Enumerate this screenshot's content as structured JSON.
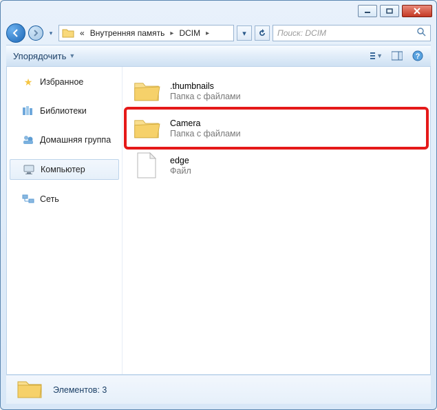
{
  "breadcrumb": {
    "prefix": "«",
    "seg1": "Внутренняя память",
    "seg2": "DCIM"
  },
  "search": {
    "placeholder": "Поиск: DCIM"
  },
  "toolbar": {
    "organize": "Упорядочить"
  },
  "nav": {
    "favorites": "Избранное",
    "libraries": "Библиотеки",
    "homegroup": "Домашняя группа",
    "computer": "Компьютер",
    "network": "Сеть"
  },
  "items": [
    {
      "name": ".thumbnails",
      "type": "Папка с файлами",
      "kind": "folder"
    },
    {
      "name": "Camera",
      "type": "Папка с файлами",
      "kind": "folder",
      "highlight": true
    },
    {
      "name": "edge",
      "type": "Файл",
      "kind": "file"
    }
  ],
  "status": {
    "text": "Элементов: 3"
  }
}
